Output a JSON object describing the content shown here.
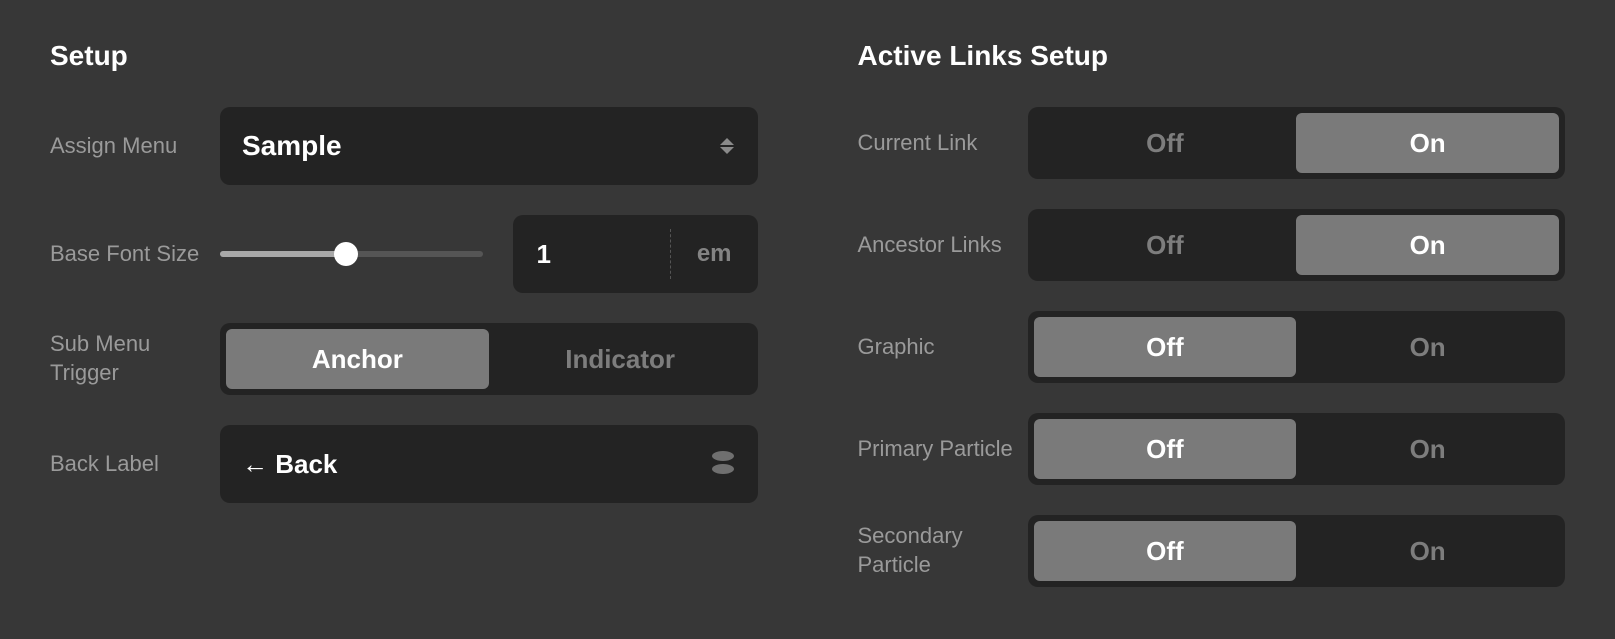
{
  "left": {
    "title": "Setup",
    "rows": {
      "assign_menu": {
        "label": "Assign Menu",
        "value": "Sample"
      },
      "base_font": {
        "label": "Base Font Size",
        "value": "1",
        "unit": "em"
      },
      "sub_trigger": {
        "label": "Sub Menu Trigger",
        "opt_a": "Anchor",
        "opt_b": "Indicator",
        "active": "a"
      },
      "back_label": {
        "label": "Back Label",
        "value": "← Back"
      }
    }
  },
  "right": {
    "title": "Active Links Setup",
    "rows": {
      "current_link": {
        "label": "Current Link",
        "opt_a": "Off",
        "opt_b": "On",
        "active": "b"
      },
      "ancestor_links": {
        "label": "Ancestor Links",
        "opt_a": "Off",
        "opt_b": "On",
        "active": "b"
      },
      "graphic": {
        "label": "Graphic",
        "opt_a": "Off",
        "opt_b": "On",
        "active": "a"
      },
      "primary_particle": {
        "label": "Primary Particle",
        "opt_a": "Off",
        "opt_b": "On",
        "active": "a"
      },
      "secondary_particle": {
        "label": "Secondary Particle",
        "opt_a": "Off",
        "opt_b": "On",
        "active": "a"
      }
    }
  }
}
